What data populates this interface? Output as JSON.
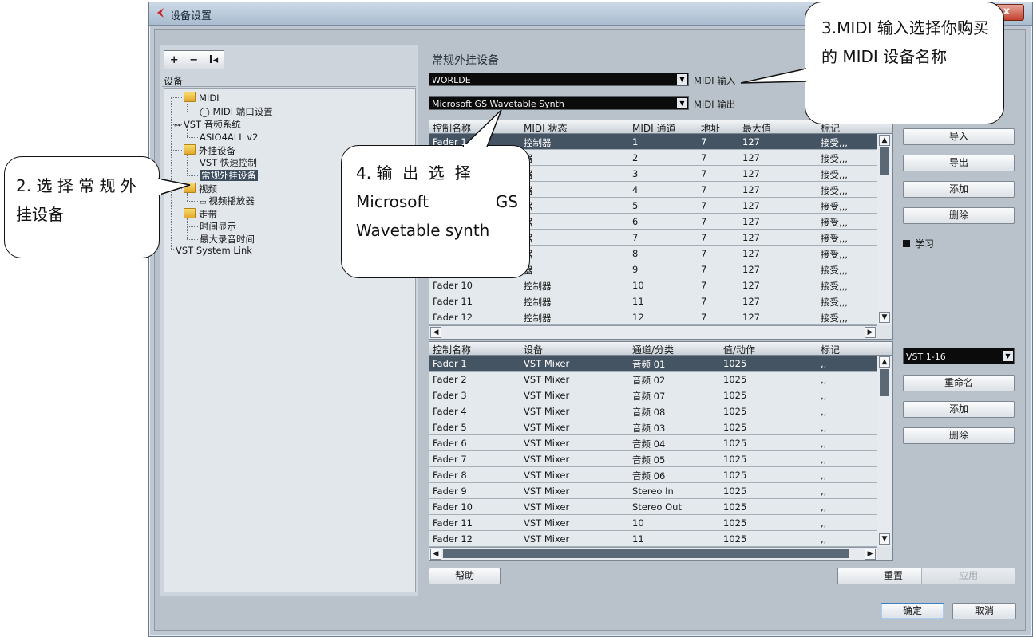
{
  "window": {
    "title": "设备设置",
    "close_label": "x"
  },
  "tree": {
    "toolbar": {
      "add": "+",
      "remove": "−",
      "reset": "I◂"
    },
    "header": "设备",
    "nodes": {
      "midi": "MIDI",
      "midi_port": "MIDI 端口设置",
      "vst_audio": "VST 音频系统",
      "asio": "ASIO4ALL v2",
      "ext_devices": "外挂设备",
      "vst_quick": "VST 快速控制",
      "generic_remote": "常规外挂设备",
      "video": "视频",
      "video_player": "视频播放器",
      "transport": "走带",
      "time_display": "时间显示",
      "max_record": "最大录音时间",
      "system_link": "VST System Link"
    }
  },
  "main": {
    "section_title": "常规外挂设备",
    "midi_in": {
      "value": "WORLDE",
      "label": "MIDI 输入"
    },
    "midi_out": {
      "value": "Microsoft GS Wavetable Synth",
      "label": "MIDI 输出"
    },
    "upper_table": {
      "headers": [
        "控制名称",
        "MIDI 状态",
        "MIDI 通道",
        "地址",
        "最大值",
        "标记"
      ],
      "rows": [
        [
          "Fader 1",
          "控制器",
          "1",
          "7",
          "127",
          "接受,,,"
        ],
        [
          "",
          "器",
          "2",
          "7",
          "127",
          "接受,,,"
        ],
        [
          "",
          "器",
          "3",
          "7",
          "127",
          "接受,,,"
        ],
        [
          "",
          "器",
          "4",
          "7",
          "127",
          "接受,,,"
        ],
        [
          "",
          "器",
          "5",
          "7",
          "127",
          "接受,,,"
        ],
        [
          "",
          "器",
          "6",
          "7",
          "127",
          "接受,,,"
        ],
        [
          "",
          "器",
          "7",
          "7",
          "127",
          "接受,,,"
        ],
        [
          "",
          "器",
          "8",
          "7",
          "127",
          "接受,,,"
        ],
        [
          "",
          "器",
          "9",
          "7",
          "127",
          "接受,,,"
        ],
        [
          "Fader 10",
          "控制器",
          "10",
          "7",
          "127",
          "接受,,,"
        ],
        [
          "Fader 11",
          "控制器",
          "11",
          "7",
          "127",
          "接受,,,"
        ],
        [
          "Fader 12",
          "控制器",
          "12",
          "7",
          "127",
          "接受,,,"
        ]
      ]
    },
    "lower_table": {
      "headers": [
        "控制名称",
        "设备",
        "通道/分类",
        "值/动作",
        "标记"
      ],
      "rows": [
        [
          "Fader 1",
          "VST Mixer",
          "音频 01",
          "1025",
          ",,"
        ],
        [
          "Fader 2",
          "VST Mixer",
          "音频 02",
          "1025",
          ",,"
        ],
        [
          "Fader 3",
          "VST Mixer",
          "音频 07",
          "1025",
          ",,"
        ],
        [
          "Fader 4",
          "VST Mixer",
          "音频 08",
          "1025",
          ",,"
        ],
        [
          "Fader 5",
          "VST Mixer",
          "音频 03",
          "1025",
          ",,"
        ],
        [
          "Fader 6",
          "VST Mixer",
          "音频 04",
          "1025",
          ",,"
        ],
        [
          "Fader 7",
          "VST Mixer",
          "音频 05",
          "1025",
          ",,"
        ],
        [
          "Fader 8",
          "VST Mixer",
          "音频 06",
          "1025",
          ",,"
        ],
        [
          "Fader 9",
          "VST Mixer",
          "Stereo In",
          "1025",
          ",,"
        ],
        [
          "Fader 10",
          "VST Mixer",
          "Stereo Out",
          "1025",
          ",,"
        ],
        [
          "Fader 11",
          "VST Mixer",
          "10",
          "1025",
          ",,"
        ],
        [
          "Fader 12",
          "VST Mixer",
          "11",
          "1025",
          ",,"
        ]
      ]
    },
    "upper_buttons": {
      "import": "导入",
      "export": "导出",
      "add": "添加",
      "delete": "删除",
      "learn": "学习"
    },
    "bank_select": "VST 1-16",
    "lower_buttons": {
      "rename": "重命名",
      "add": "添加",
      "delete": "删除"
    },
    "help": "帮助",
    "reset": "重置",
    "apply": "应用",
    "ok": "确定",
    "cancel": "取消"
  },
  "annotations": {
    "step2": "2. 选 择 常 规 外挂设备",
    "step3": "3.MIDI 输入选择你购买的 MIDI 设备名称",
    "step4_line1": "4. 输  出  选  择",
    "step4_line2a": "Microsoft",
    "step4_line2b": "GS",
    "step4_line3": "Wavetable synth"
  }
}
